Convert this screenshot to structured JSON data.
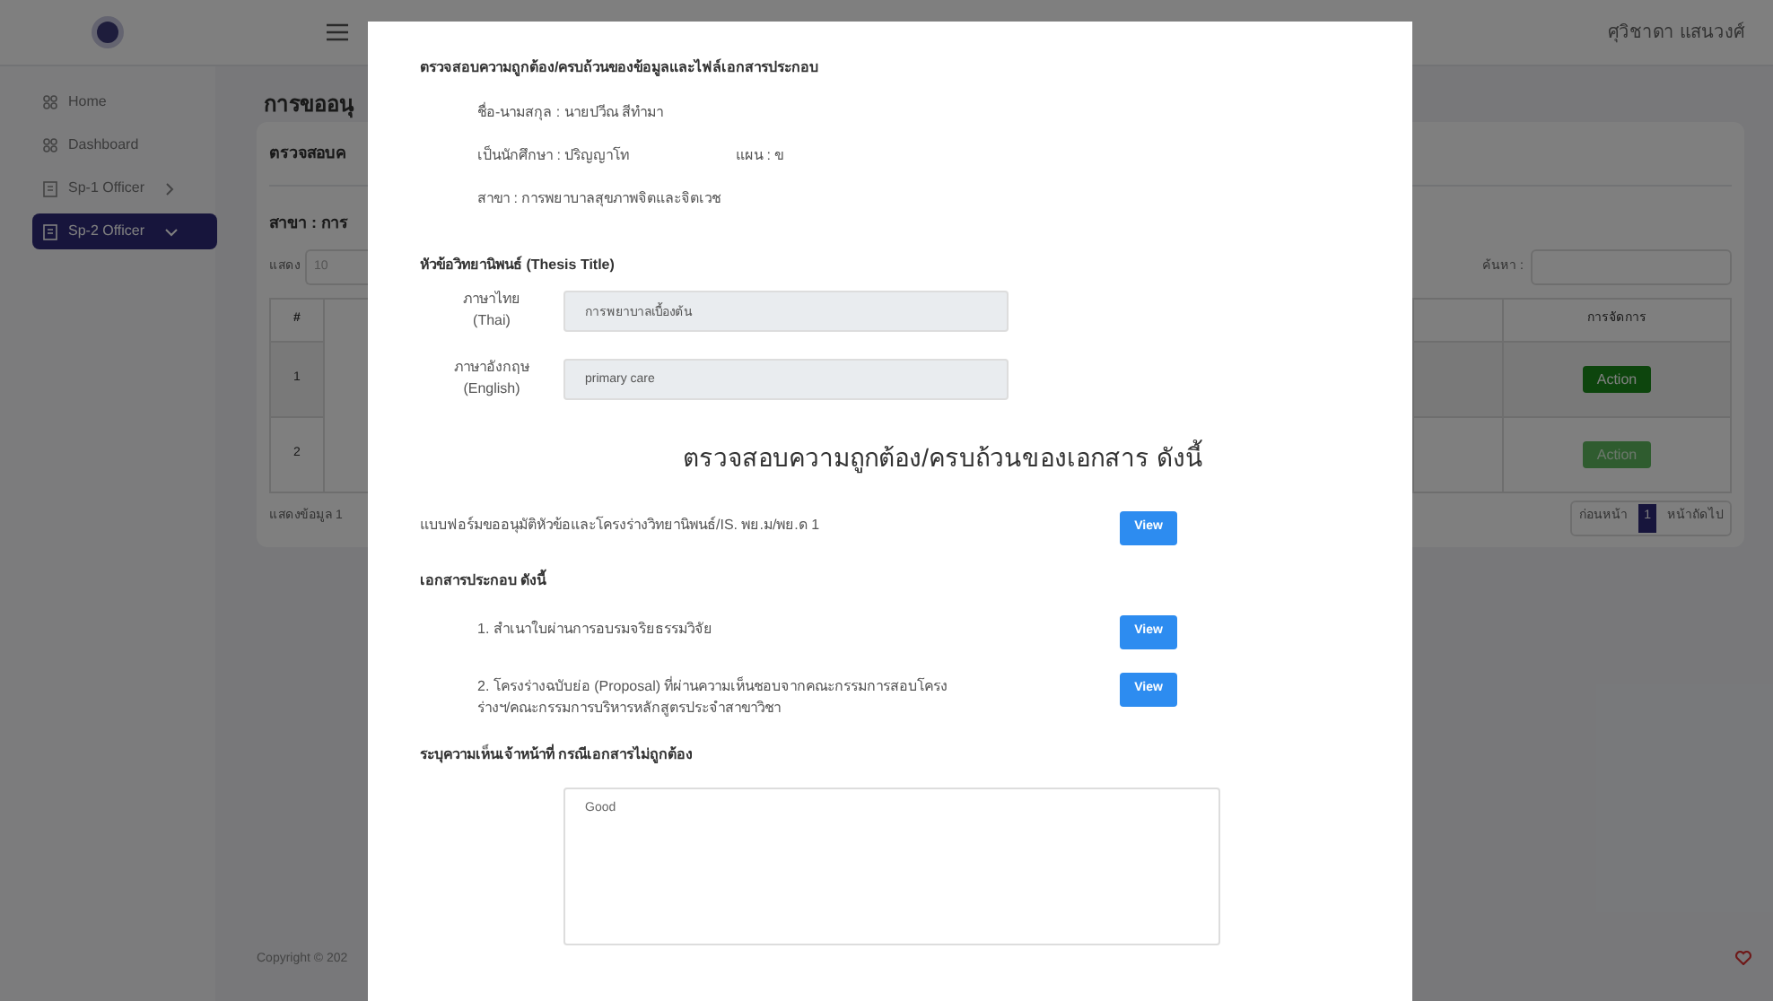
{
  "header": {
    "user_name": "ศุวิชาดา แสนวงศ์"
  },
  "sidebar": {
    "items": [
      {
        "label": "Home",
        "kind": "link",
        "selected": false
      },
      {
        "label": "Dashboard",
        "kind": "link",
        "selected": false
      },
      {
        "label": "Sp-1 Officer",
        "kind": "menu",
        "expanded": false,
        "selected": false
      },
      {
        "label": "Sp-2 Officer",
        "kind": "menu",
        "expanded": true,
        "selected": true
      }
    ]
  },
  "page": {
    "title": "การขออนุ",
    "card_title": "ตรวจสอบค",
    "branch": "สาขา : การ",
    "length_label": "แสดง",
    "length_value": "10",
    "search_label": "ค้นหา :",
    "table": {
      "columns": [
        "#",
        "การจัดการ"
      ],
      "rows": [
        {
          "number": "1",
          "action": "Action",
          "disabled": false
        },
        {
          "number": "2",
          "action": "Action",
          "disabled": true
        }
      ]
    },
    "info": "แสดงข้อมูล 1",
    "pagination": {
      "previous": "ก่อนหน้า",
      "pages": [
        {
          "label": "1",
          "selected": true
        }
      ],
      "next": "หน้าถัดไป"
    },
    "copyright": "Copyright © 202"
  },
  "modal": {
    "section_title": "ตรวจสอบความถูกต้อง/ครบถ้วนของข้อมูลและไฟล์เอกสารประกอบ",
    "student": {
      "name": "ชื่อ-นามสกุล : นายปวีณ สีทำมา",
      "level": "เป็นนักศึกษา : ปริญญาโท",
      "plan": "แผน : ข",
      "branch": "สาขา : การพยาบาลสุขภาพจิตและจิตเวช"
    },
    "thesis_heading": "หัวข้อวิทยานิพนธ์ (Thesis Title)",
    "thesis_fields": [
      {
        "label": "ภาษาไทย",
        "sublabel": "(Thai)",
        "value": "การพยาบาลเบื้องต้น"
      },
      {
        "label": "ภาษาอังกฤษ",
        "sublabel": "(English)",
        "value": "primary care"
      }
    ],
    "documents_heading": "ตรวจสอบความถูกต้อง/ครบถ้วนของเอกสาร ดังนี้",
    "main_document": {
      "text": "แบบฟอร์มขออนุมัติหัวข้อและโครงร่างวิทยานิพนธ์/IS. พย.ม/พย.ด 1",
      "button": "View"
    },
    "attachments_heading": "เอกสารประกอบ ดังนี้",
    "attachments": [
      {
        "text": "1. สำเนาใบผ่านการอบรมจริยธรรมวิจัย",
        "button": "View"
      },
      {
        "text": "2. โครงร่างฉบับย่อ (Proposal) ที่ผ่านความเห็นชอบจากคณะกรรมการสอบโครงร่างฯ/คณะกรรมการบริหารหลักสูตรประจำสาขาวิชา",
        "button": "View"
      }
    ],
    "comment_label": "ระบุความเห็นเจ้าหน้าที่ กรณีเอกสารไม่ถูกต้อง",
    "comment": {
      "value": "Good"
    }
  }
}
